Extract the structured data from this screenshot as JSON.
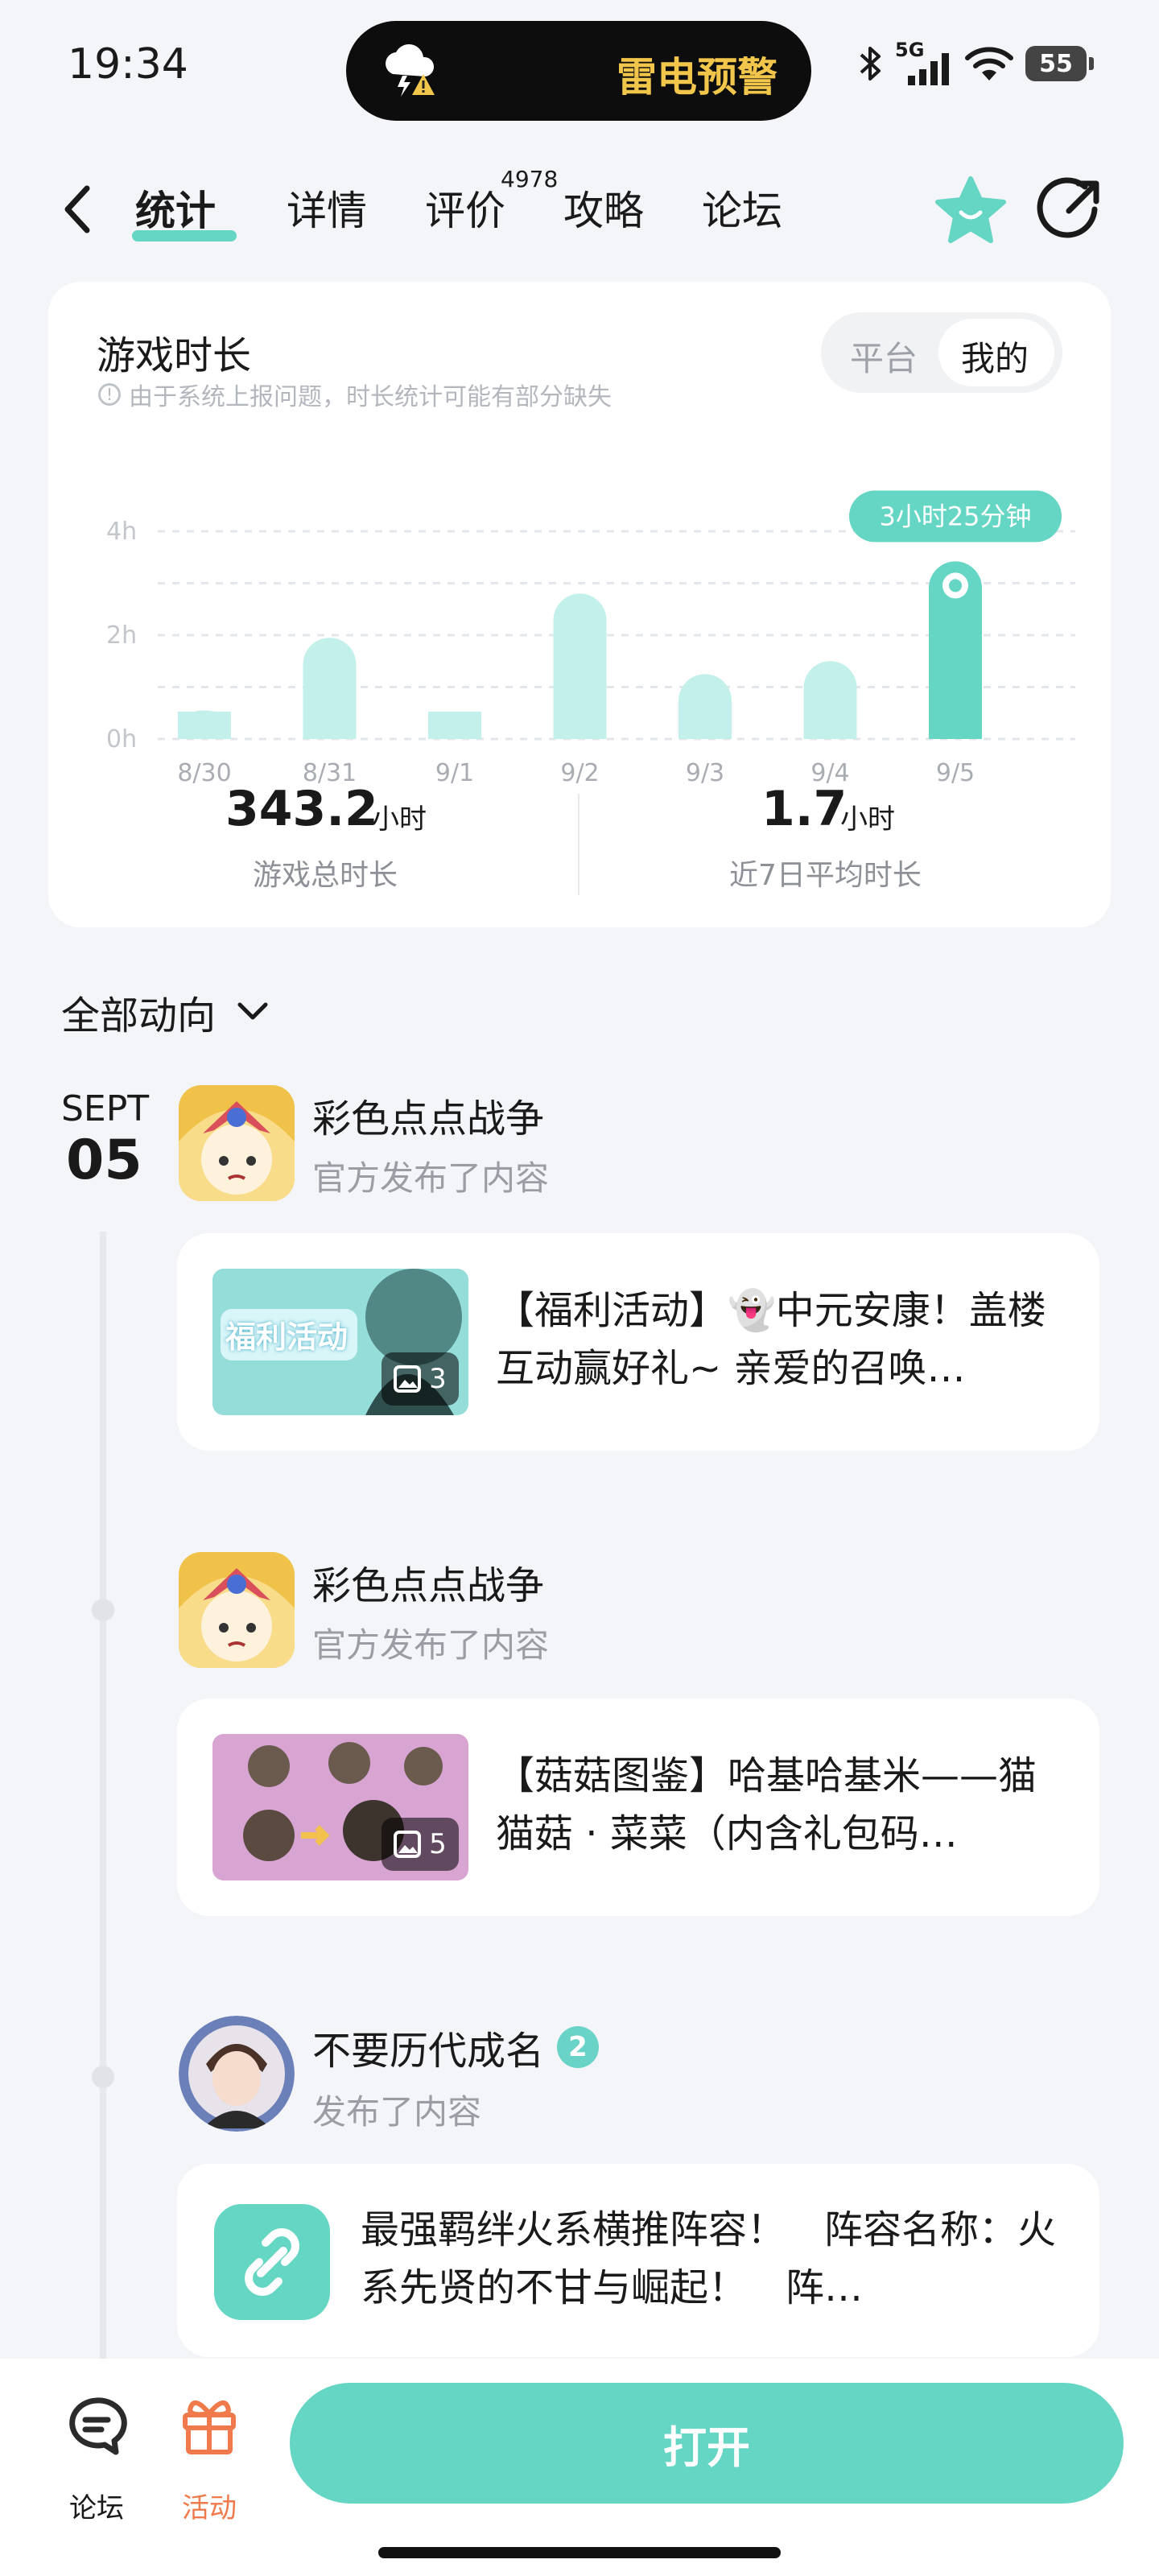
{
  "status_bar": {
    "time": "19:34",
    "alert": "雷电预警",
    "network": "5G",
    "battery": "55"
  },
  "nav": {
    "tabs": [
      {
        "label": "统计",
        "active": true
      },
      {
        "label": "详情"
      },
      {
        "label": "评价",
        "badge": "4978"
      },
      {
        "label": "攻略"
      },
      {
        "label": "论坛"
      }
    ]
  },
  "stats": {
    "title": "游戏时长",
    "notice": "由于系统上报问题，时长统计可能有部分缺失",
    "toggle": [
      "平台",
      "我的"
    ],
    "toggle_selected": "我的",
    "total": {
      "value": "343.2",
      "unit": "小时",
      "label": "游戏总时长"
    },
    "average": {
      "value": "1.7",
      "unit": "小时",
      "label": "近7日平均时长"
    }
  },
  "chart_data": {
    "type": "bar",
    "categories": [
      "8/30",
      "8/31",
      "9/1",
      "9/2",
      "9/3",
      "9/4",
      "9/5"
    ],
    "values": [
      0.55,
      1.95,
      0.4,
      2.8,
      1.25,
      1.5,
      3.42
    ],
    "ylim": [
      0,
      4
    ],
    "yticks": [
      "0h",
      "2h",
      "4h"
    ],
    "grid": true,
    "highlight_index": 6,
    "highlight_label": "3小时25分钟",
    "colors": {
      "bar": "#c4f0ec",
      "highlight": "#65d5c4"
    }
  },
  "feed": {
    "filter_label": "全部动向",
    "date": {
      "month": "SEPT",
      "day": "05"
    },
    "posts": [
      {
        "author": "彩色点点战争",
        "action": "官方发布了内容",
        "text": "【福利活动】👻中元安康！盖楼互动赢好礼~ 亲爱的召唤…",
        "image_count": "3",
        "thumb_text": "福利活动"
      },
      {
        "author": "彩色点点战争",
        "action": "官方发布了内容",
        "text": "【菇菇图鉴】哈基哈基米——猫猫菇 · 菜菜（内含礼包码…",
        "image_count": "5"
      },
      {
        "author": "不要历代成名",
        "author_badge": "2",
        "action": "发布了内容",
        "text": "最强羁绊火系横推阵容！　阵容名称：火系先贤的不甘与崛起！　阵…"
      }
    ]
  },
  "bottom_bar": {
    "forum_label": "论坛",
    "activity_label": "活动",
    "open_label": "打开"
  },
  "colors": {
    "accent": "#65d5c4",
    "activity": "#f07a4b",
    "alert": "#f2c54b"
  }
}
